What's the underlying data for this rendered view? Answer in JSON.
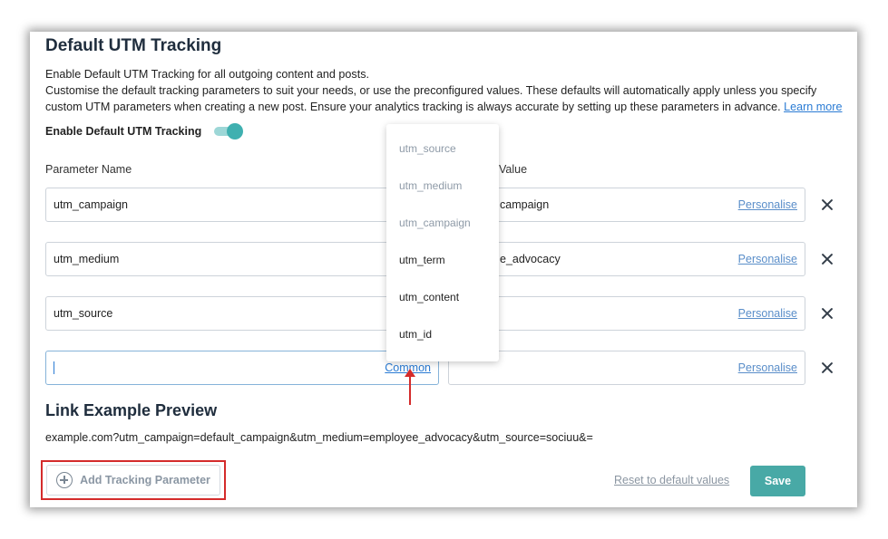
{
  "header": {
    "title": "Default UTM Tracking",
    "line1": "Enable Default UTM Tracking for all outgoing content and posts.",
    "line2": "Customise the default tracking parameters to suit your needs, or use the preconfigured values. These defaults will automatically apply unless you specify custom UTM parameters when creating a new post. Ensure your analytics tracking is always accurate by setting up these parameters in advance.",
    "learn_more": "Learn more"
  },
  "toggle": {
    "label": "Enable Default UTM Tracking",
    "on": true,
    "color": "#3fb0b0"
  },
  "columns": {
    "name_label": "Parameter Name",
    "value_label_visible": "Value"
  },
  "rows": [
    {
      "name": "utm_campaign",
      "value_visible": "campaign",
      "personalise": "Personalise"
    },
    {
      "name": "utm_medium",
      "value_visible": "e_advocacy",
      "personalise": "Personalise"
    },
    {
      "name": "utm_source",
      "value_visible": "",
      "personalise": "Personalise"
    },
    {
      "name": "",
      "common": "Common",
      "value_visible": "",
      "personalise": "Personalise"
    }
  ],
  "dropdown": {
    "options": [
      {
        "label": "utm_source",
        "disabled": true
      },
      {
        "label": "utm_medium",
        "disabled": true
      },
      {
        "label": "utm_campaign",
        "disabled": true
      },
      {
        "label": "utm_term",
        "disabled": false
      },
      {
        "label": "utm_content",
        "disabled": false
      },
      {
        "label": "utm_id",
        "disabled": false
      }
    ]
  },
  "preview": {
    "title": "Link Example Preview",
    "url": "example.com?utm_campaign=default_campaign&utm_medium=employee_advocacy&utm_source=sociuu&="
  },
  "footer": {
    "add_label": "Add Tracking Parameter",
    "reset_label": "Reset to default values",
    "save_label": "Save"
  },
  "colors": {
    "accent": "#48a9a6",
    "link": "#2a7bd4",
    "annotation": "#d42b2b"
  },
  "icons": {
    "remove": "close-icon",
    "add": "plus-circle-icon"
  }
}
